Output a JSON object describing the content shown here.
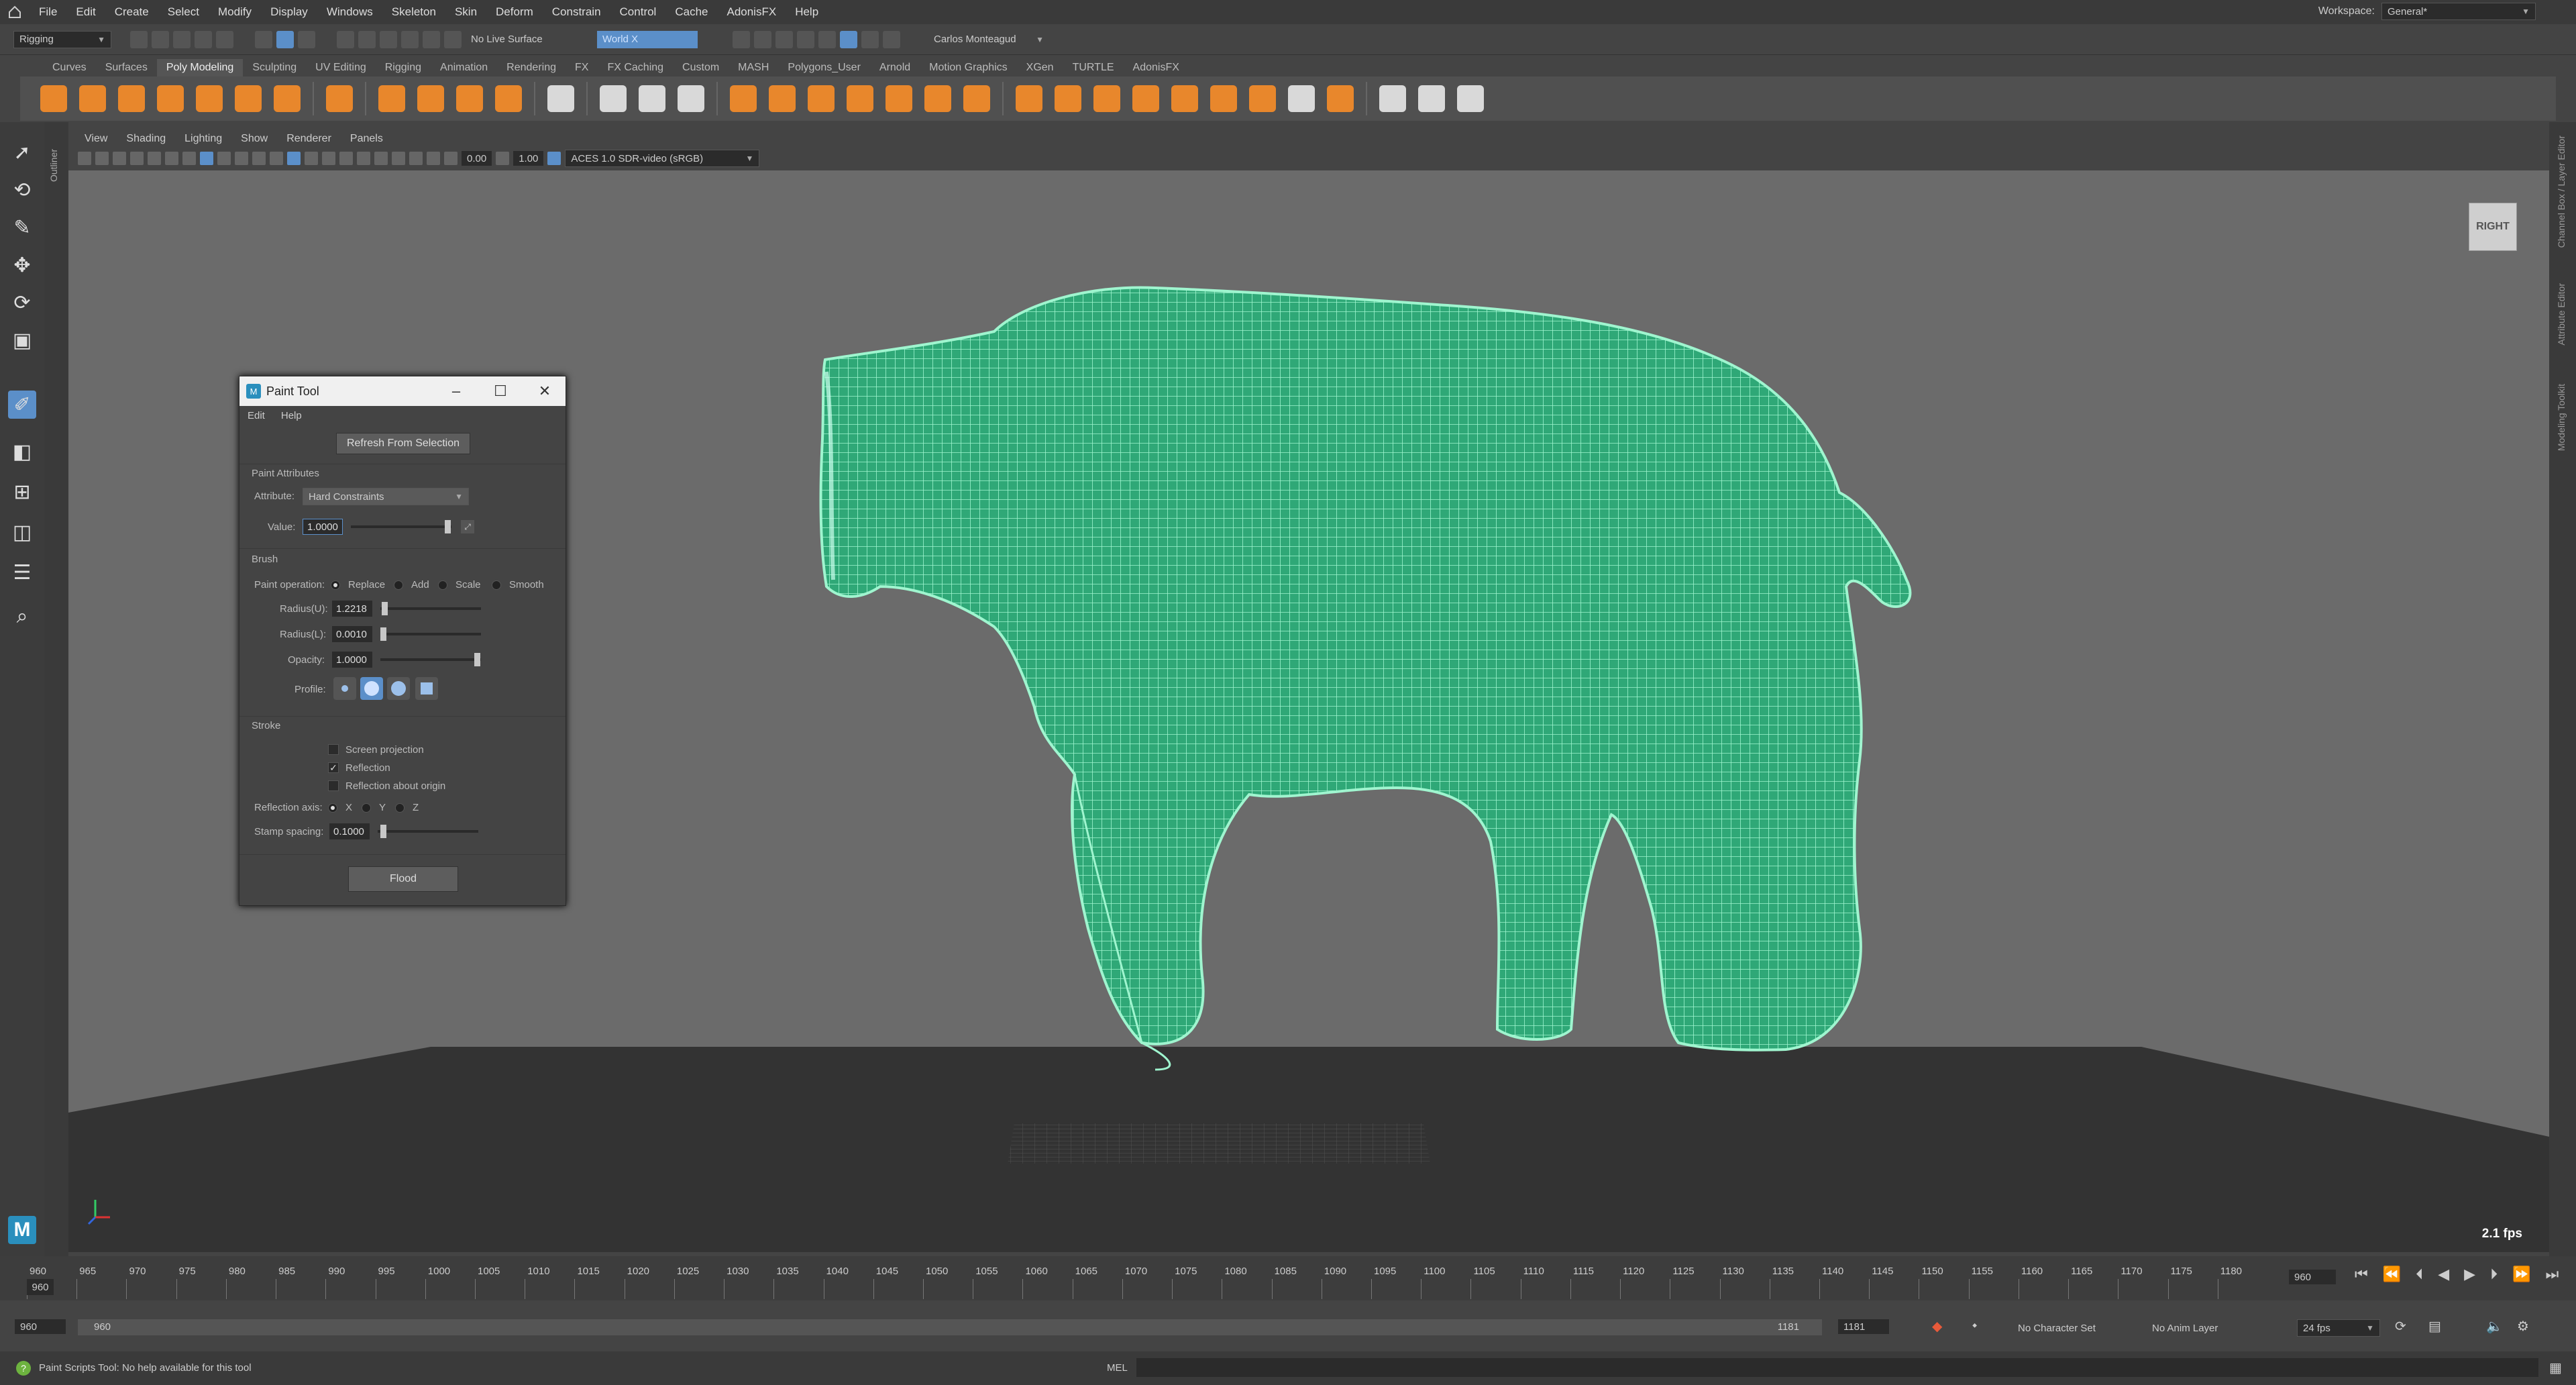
{
  "menubar": {
    "items": [
      "File",
      "Edit",
      "Create",
      "Select",
      "Modify",
      "Display",
      "Windows",
      "Skeleton",
      "Skin",
      "Deform",
      "Constrain",
      "Control",
      "Cache",
      "AdonisFX",
      "Help"
    ],
    "workspace_label": "Workspace:",
    "workspace_value": "General*"
  },
  "statusline": {
    "menuset": "Rigging",
    "live_surface": "No Live Surface",
    "world": "World X",
    "user": "Carlos Monteagud"
  },
  "shelf": {
    "tabs": [
      "Curves",
      "Surfaces",
      "Poly Modeling",
      "Sculpting",
      "UV Editing",
      "Rigging",
      "Animation",
      "Rendering",
      "FX",
      "FX Caching",
      "Custom",
      "MASH",
      "Polygons_User",
      "Arnold",
      "Motion Graphics",
      "XGen",
      "TURTLE",
      "AdonisFX"
    ],
    "active_tab": "Poly Modeling"
  },
  "outliner_label": "Outliner",
  "right_panels": [
    "Channel Box / Layer Editor",
    "Attribute Editor",
    "Modeling Toolkit"
  ],
  "viewport": {
    "menu": [
      "View",
      "Shading",
      "Lighting",
      "Show",
      "Renderer",
      "Panels"
    ],
    "exposure": "0.00",
    "gamma": "1.00",
    "colorspace": "ACES 1.0 SDR-video (sRGB)",
    "view_cube": "RIGHT",
    "fps": "2.1 fps"
  },
  "paint_tool": {
    "title": "Paint Tool",
    "menu": [
      "Edit",
      "Help"
    ],
    "refresh_button": "Refresh From Selection",
    "paint_attributes_header": "Paint Attributes",
    "attribute_label": "Attribute:",
    "attribute_value": "Hard Constraints",
    "value_label": "Value:",
    "value": "1.0000",
    "brush_header": "Brush",
    "paint_operation_label": "Paint operation:",
    "operations": [
      "Replace",
      "Add",
      "Scale",
      "Smooth"
    ],
    "radius_u_label": "Radius(U):",
    "radius_u": "1.2218",
    "radius_l_label": "Radius(L):",
    "radius_l": "0.0010",
    "opacity_label": "Opacity:",
    "opacity": "1.0000",
    "profile_label": "Profile:",
    "stroke_header": "Stroke",
    "screen_projection": "Screen projection",
    "reflection": "Reflection",
    "reflection_origin": "Reflection about origin",
    "reflection_axis_label": "Reflection axis:",
    "axes": [
      "X",
      "Y",
      "Z"
    ],
    "stamp_spacing_label": "Stamp spacing:",
    "stamp_spacing": "0.1000",
    "flood_button": "Flood"
  },
  "timeline": {
    "ticks": [
      "960",
      "965",
      "970",
      "975",
      "980",
      "985",
      "990",
      "995",
      "1000",
      "1005",
      "1010",
      "1015",
      "1020",
      "1025",
      "1030",
      "1035",
      "1040",
      "1045",
      "1050",
      "1055",
      "1060",
      "1065",
      "1070",
      "1075",
      "1080",
      "1085",
      "1090",
      "1095",
      "1100",
      "1105",
      "1110",
      "1115",
      "1120",
      "1125",
      "1130",
      "1135",
      "1140",
      "1145",
      "1150",
      "1155",
      "1160",
      "1165",
      "1170",
      "1175",
      "1180"
    ],
    "current_marker": "960",
    "current_frame": "960"
  },
  "range": {
    "start": "960",
    "inner_start": "960",
    "inner_end": "1181",
    "end": "1181",
    "character_set": "No Character Set",
    "anim_layer": "No Anim Layer",
    "fps": "24 fps"
  },
  "helpline": {
    "message": "Paint Scripts Tool: No help available for this tool",
    "mel_label": "MEL"
  },
  "colors": {
    "mesh_wire": "#57e6a8",
    "accent_blue": "#5b8fc9",
    "shelf_orange": "#e8872c"
  }
}
